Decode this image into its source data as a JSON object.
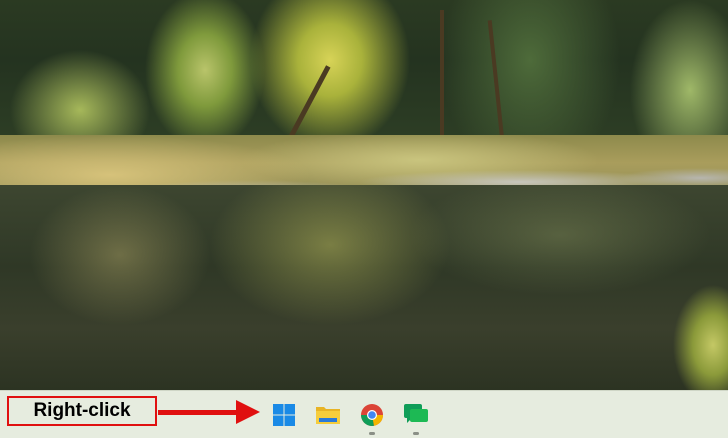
{
  "annotation": {
    "label": "Right-click",
    "color": "#e01010"
  },
  "taskbar": {
    "background": "#e6ecdf",
    "items": [
      {
        "name": "start-button",
        "icon": "windows-logo-icon",
        "running": false
      },
      {
        "name": "file-explorer",
        "icon": "folder-icon",
        "running": false
      },
      {
        "name": "chrome",
        "icon": "chrome-icon",
        "running": true
      },
      {
        "name": "chat",
        "icon": "chat-icon",
        "running": true
      }
    ]
  }
}
